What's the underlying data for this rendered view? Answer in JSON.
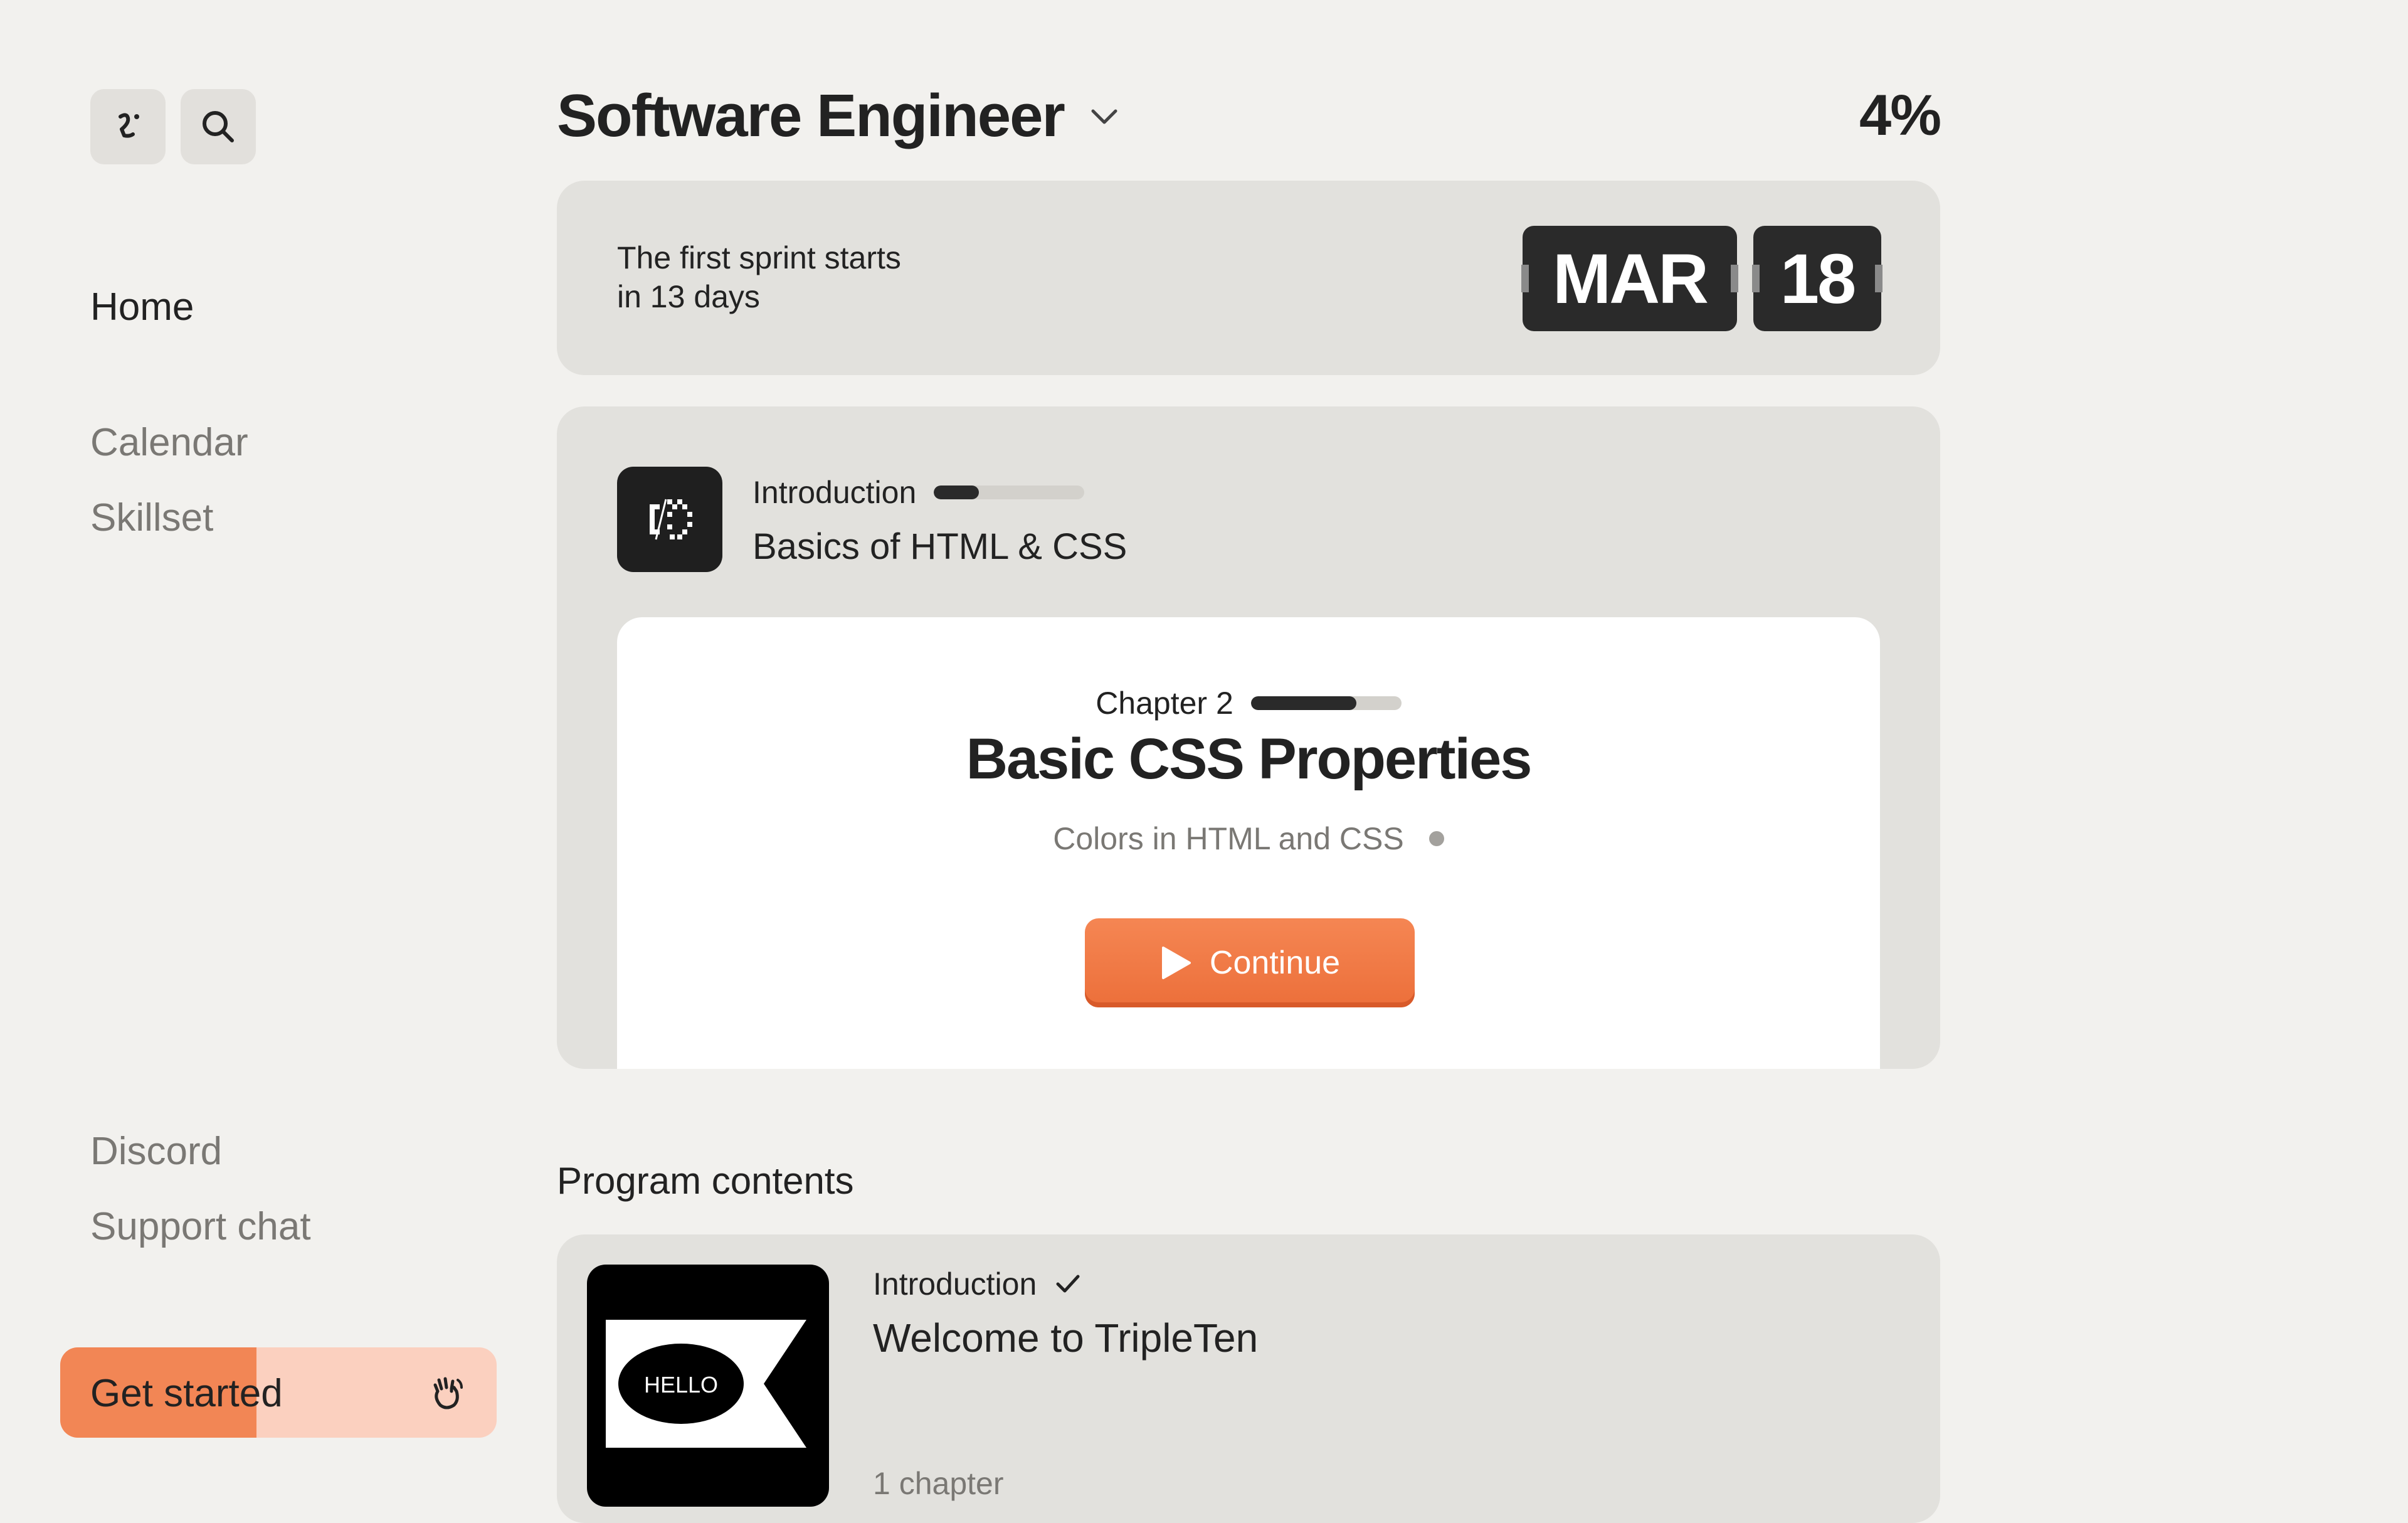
{
  "sidebar": {
    "nav": {
      "home": "Home",
      "calendar": "Calendar",
      "skillset": "Skillset",
      "discord": "Discord",
      "support": "Support chat"
    },
    "get_started": {
      "label": "Get started",
      "progress": 0.45
    }
  },
  "header": {
    "program": "Software Engineer",
    "progress": "4%"
  },
  "sprint": {
    "text_line1": "The first sprint starts",
    "text_line2": "in 13 days",
    "month": "MAR",
    "day": "18"
  },
  "course": {
    "kicker": "Introduction",
    "progress": 0.3,
    "name": "Basics of HTML & CSS",
    "chapter": {
      "label": "Chapter 2",
      "progress": 0.7,
      "title": "Basic CSS Properties",
      "lesson": "Colors in HTML and CSS",
      "continue": "Continue"
    }
  },
  "program_contents": {
    "title": "Program contents",
    "items": [
      {
        "kicker": "Introduction",
        "title": "Welcome to TripleTen",
        "meta": "1 chapter",
        "thumb_text": "HELLO",
        "completed": true
      }
    ]
  },
  "colors": {
    "accent": "#f28655",
    "accent_light": "#fbd0bf",
    "card": "#e2e1dd",
    "background": "#f2f1ee",
    "dark": "#2a2a2a"
  },
  "icons": [
    "profile-face-icon",
    "search-icon",
    "chevron-down-icon",
    "waving-hand-icon",
    "play-icon",
    "checkmark-icon",
    "course-code-icon"
  ]
}
